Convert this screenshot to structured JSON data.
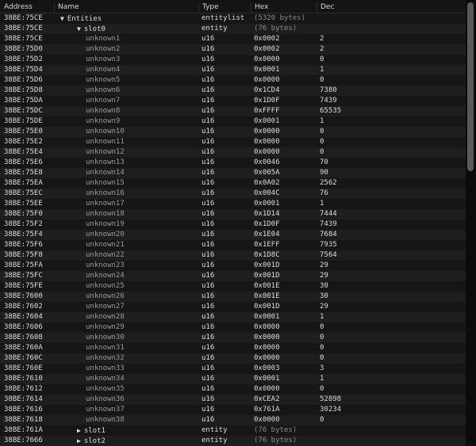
{
  "columns": {
    "address": "Address",
    "name": "Name",
    "type": "Type",
    "hex": "Hex",
    "dec": "Dec"
  },
  "rows": [
    {
      "addr": "38BE:75CE",
      "name": "Entities",
      "type": "entitylist",
      "hex": "(5320 bytes)",
      "dec": "",
      "indent": 0,
      "expander": "▼"
    },
    {
      "addr": "38BE:75CE",
      "name": "slot0",
      "type": "entity",
      "hex": "(76 bytes)",
      "dec": "",
      "indent": 1,
      "expander": "▼"
    },
    {
      "addr": "38BE:75CE",
      "name": "unknown1",
      "type": "u16",
      "hex": "0x0002",
      "dec": "2",
      "indent": 2
    },
    {
      "addr": "38BE:75D0",
      "name": "unknown2",
      "type": "u16",
      "hex": "0x0002",
      "dec": "2",
      "indent": 2
    },
    {
      "addr": "38BE:75D2",
      "name": "unknown3",
      "type": "u16",
      "hex": "0x0000",
      "dec": "0",
      "indent": 2
    },
    {
      "addr": "38BE:75D4",
      "name": "unknown4",
      "type": "u16",
      "hex": "0x0001",
      "dec": "1",
      "indent": 2
    },
    {
      "addr": "38BE:75D6",
      "name": "unknown5",
      "type": "u16",
      "hex": "0x0000",
      "dec": "0",
      "indent": 2
    },
    {
      "addr": "38BE:75D8",
      "name": "unknown6",
      "type": "u16",
      "hex": "0x1CD4",
      "dec": "7380",
      "indent": 2
    },
    {
      "addr": "38BE:75DA",
      "name": "unknown7",
      "type": "u16",
      "hex": "0x1D0F",
      "dec": "7439",
      "indent": 2
    },
    {
      "addr": "38BE:75DC",
      "name": "unknown8",
      "type": "u16",
      "hex": "0xFFFF",
      "dec": "65535",
      "indent": 2
    },
    {
      "addr": "38BE:75DE",
      "name": "unknown9",
      "type": "u16",
      "hex": "0x0001",
      "dec": "1",
      "indent": 2
    },
    {
      "addr": "38BE:75E0",
      "name": "unknown10",
      "type": "u16",
      "hex": "0x0000",
      "dec": "0",
      "indent": 2
    },
    {
      "addr": "38BE:75E2",
      "name": "unknown11",
      "type": "u16",
      "hex": "0x0000",
      "dec": "0",
      "indent": 2
    },
    {
      "addr": "38BE:75E4",
      "name": "unknown12",
      "type": "u16",
      "hex": "0x0000",
      "dec": "0",
      "indent": 2
    },
    {
      "addr": "38BE:75E6",
      "name": "unknown13",
      "type": "u16",
      "hex": "0x0046",
      "dec": "70",
      "indent": 2
    },
    {
      "addr": "38BE:75E8",
      "name": "unknown14",
      "type": "u16",
      "hex": "0x005A",
      "dec": "90",
      "indent": 2
    },
    {
      "addr": "38BE:75EA",
      "name": "unknown15",
      "type": "u16",
      "hex": "0x0A02",
      "dec": "2562",
      "indent": 2
    },
    {
      "addr": "38BE:75EC",
      "name": "unknown16",
      "type": "u16",
      "hex": "0x004C",
      "dec": "76",
      "indent": 2
    },
    {
      "addr": "38BE:75EE",
      "name": "unknown17",
      "type": "u16",
      "hex": "0x0001",
      "dec": "1",
      "indent": 2
    },
    {
      "addr": "38BE:75F0",
      "name": "unknown18",
      "type": "u16",
      "hex": "0x1D14",
      "dec": "7444",
      "indent": 2
    },
    {
      "addr": "38BE:75F2",
      "name": "unknown19",
      "type": "u16",
      "hex": "0x1D0F",
      "dec": "7439",
      "indent": 2
    },
    {
      "addr": "38BE:75F4",
      "name": "unknown20",
      "type": "u16",
      "hex": "0x1E04",
      "dec": "7684",
      "indent": 2
    },
    {
      "addr": "38BE:75F6",
      "name": "unknown21",
      "type": "u16",
      "hex": "0x1EFF",
      "dec": "7935",
      "indent": 2
    },
    {
      "addr": "38BE:75F8",
      "name": "unknown22",
      "type": "u16",
      "hex": "0x1D8C",
      "dec": "7564",
      "indent": 2
    },
    {
      "addr": "38BE:75FA",
      "name": "unknown23",
      "type": "u16",
      "hex": "0x001D",
      "dec": "29",
      "indent": 2
    },
    {
      "addr": "38BE:75FC",
      "name": "unknown24",
      "type": "u16",
      "hex": "0x001D",
      "dec": "29",
      "indent": 2
    },
    {
      "addr": "38BE:75FE",
      "name": "unknown25",
      "type": "u16",
      "hex": "0x001E",
      "dec": "30",
      "indent": 2
    },
    {
      "addr": "38BE:7600",
      "name": "unknown26",
      "type": "u16",
      "hex": "0x001E",
      "dec": "30",
      "indent": 2
    },
    {
      "addr": "38BE:7602",
      "name": "unknown27",
      "type": "u16",
      "hex": "0x001D",
      "dec": "29",
      "indent": 2
    },
    {
      "addr": "38BE:7604",
      "name": "unknown28",
      "type": "u16",
      "hex": "0x0001",
      "dec": "1",
      "indent": 2
    },
    {
      "addr": "38BE:7606",
      "name": "unknown29",
      "type": "u16",
      "hex": "0x0000",
      "dec": "0",
      "indent": 2
    },
    {
      "addr": "38BE:7608",
      "name": "unknown30",
      "type": "u16",
      "hex": "0x0000",
      "dec": "0",
      "indent": 2
    },
    {
      "addr": "38BE:760A",
      "name": "unknown31",
      "type": "u16",
      "hex": "0x0000",
      "dec": "0",
      "indent": 2
    },
    {
      "addr": "38BE:760C",
      "name": "unknown32",
      "type": "u16",
      "hex": "0x0000",
      "dec": "0",
      "indent": 2
    },
    {
      "addr": "38BE:760E",
      "name": "unknown33",
      "type": "u16",
      "hex": "0x0003",
      "dec": "3",
      "indent": 2
    },
    {
      "addr": "38BE:7610",
      "name": "unknown34",
      "type": "u16",
      "hex": "0x0001",
      "dec": "1",
      "indent": 2
    },
    {
      "addr": "38BE:7612",
      "name": "unknown35",
      "type": "u16",
      "hex": "0x0000",
      "dec": "0",
      "indent": 2
    },
    {
      "addr": "38BE:7614",
      "name": "unknown36",
      "type": "u16",
      "hex": "0xCEA2",
      "dec": "52898",
      "indent": 2
    },
    {
      "addr": "38BE:7616",
      "name": "unknown37",
      "type": "u16",
      "hex": "0x761A",
      "dec": "30234",
      "indent": 2
    },
    {
      "addr": "38BE:7618",
      "name": "unknown38",
      "type": "u16",
      "hex": "0x0000",
      "dec": "0",
      "indent": 2
    },
    {
      "addr": "38BE:761A",
      "name": "slot1",
      "type": "entity",
      "hex": "(76 bytes)",
      "dec": "",
      "indent": 1,
      "expander": "▶"
    },
    {
      "addr": "38BE:7666",
      "name": "slot2",
      "type": "entity",
      "hex": "(76 bytes)",
      "dec": "",
      "indent": 1,
      "expander": "▶"
    }
  ],
  "scrollbar": {
    "position": 0.0,
    "visible_fraction": 0.38
  }
}
